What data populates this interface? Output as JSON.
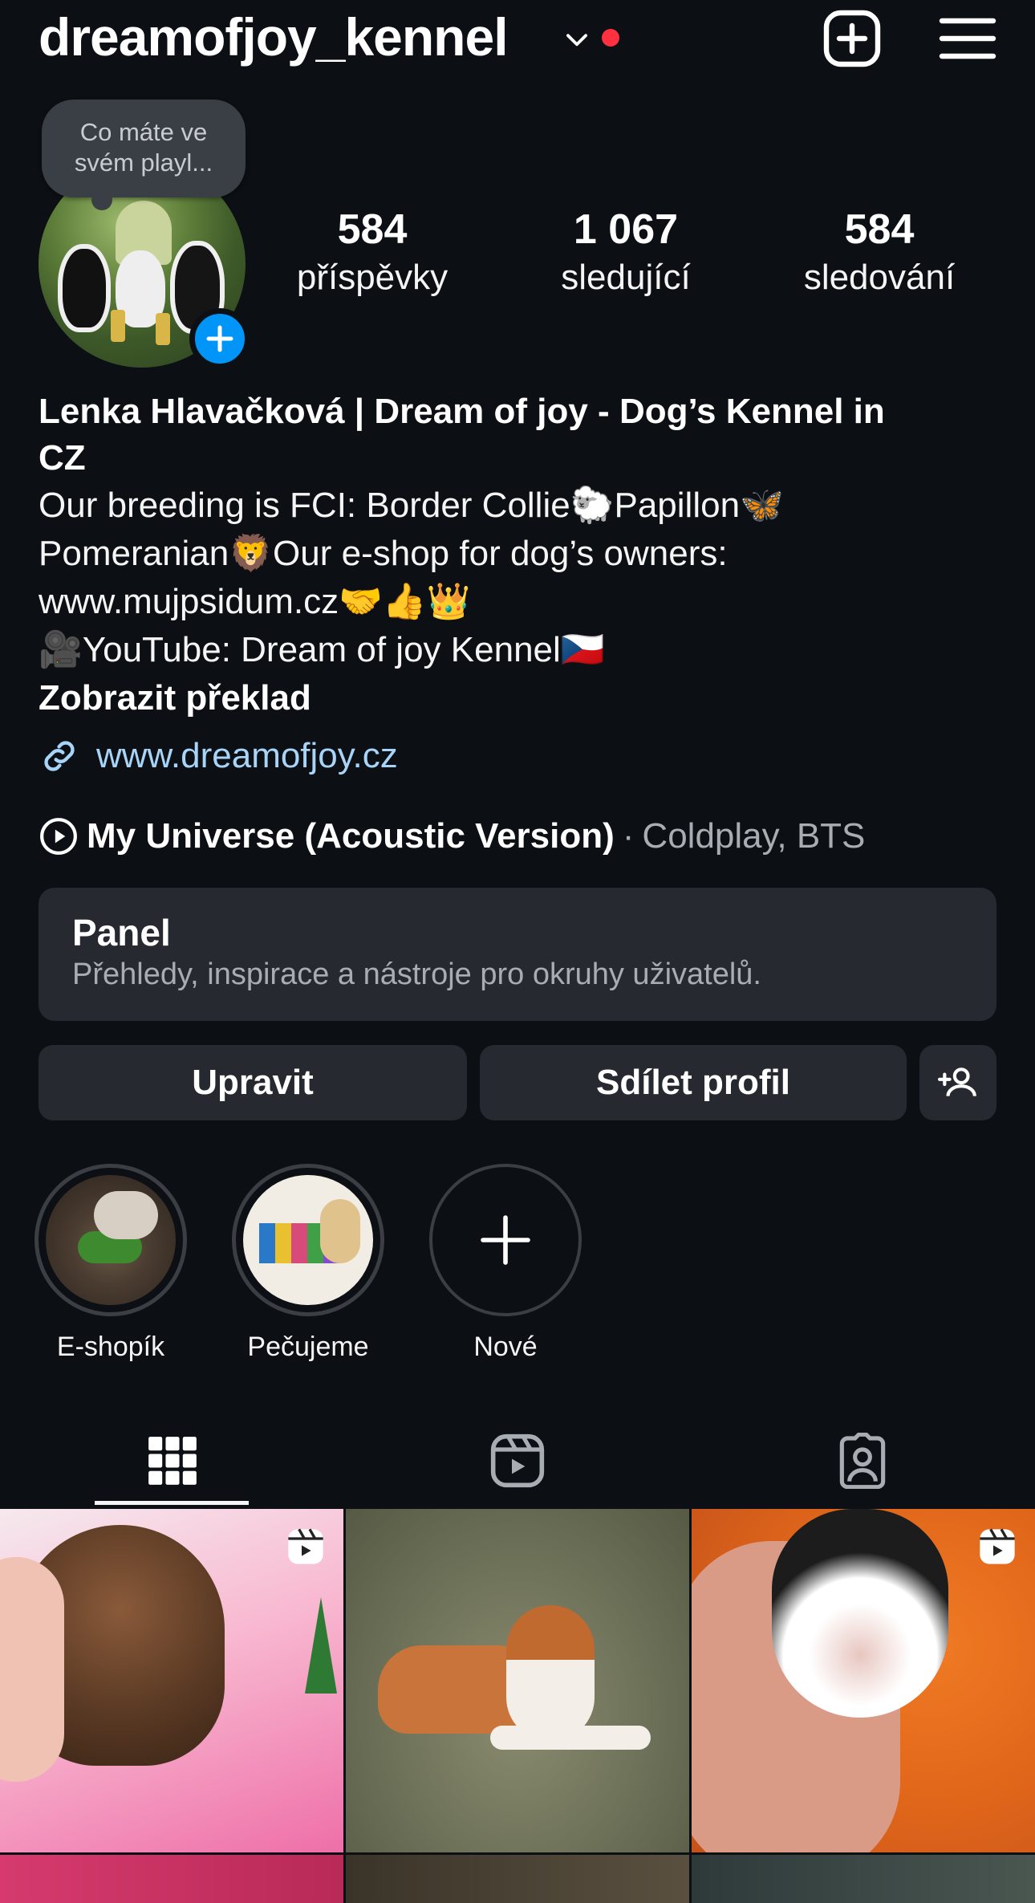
{
  "header": {
    "username": "dreamofjoy_kennel",
    "notification_dot_color": "#ff3040",
    "icons": [
      "chevron-down-icon",
      "create-plus-icon",
      "menu-icon"
    ]
  },
  "profile": {
    "note": "Co máte ve svém playl...",
    "stats": [
      {
        "value": "584",
        "label": "příspěvky"
      },
      {
        "value": "1 067",
        "label": "sledující"
      },
      {
        "value": "584",
        "label": "sledování"
      }
    ]
  },
  "bio": {
    "name_line1": "Lenka Hlavačková | Dream of joy - Dog’s Kennel in",
    "name_line2": "CZ",
    "line1": "Our breeding is FCI: Border Collie🐑Papillon🦋",
    "line2": "Pomeranian🦁Our e-shop for dog’s owners:",
    "line3": "www.mujpsidum.cz🤝👍👑",
    "line4": "🎥YouTube: Dream of joy Kennel🇨🇿",
    "translate": "Zobrazit překlad",
    "link": "www.dreamofjoy.cz"
  },
  "music": {
    "title": "My Universe (Acoustic Version)",
    "separator": "·",
    "artist": "Coldplay, BTS"
  },
  "panel": {
    "title": "Panel",
    "subtitle": "Přehledy, inspirace a nástroje pro okruhy uživatelů."
  },
  "actions": {
    "edit": "Upravit",
    "share": "Sdílet profil"
  },
  "highlights": [
    {
      "label": "E-shopík"
    },
    {
      "label": "Pečujeme"
    },
    {
      "label": "Nové"
    }
  ],
  "tabs": [
    "grid-icon",
    "reels-icon",
    "tagged-icon"
  ],
  "colors": {
    "background": "#0c1014",
    "accent_blue": "#0095f6",
    "link_blue": "#a8d4f8",
    "button_bg": "#262a30"
  }
}
